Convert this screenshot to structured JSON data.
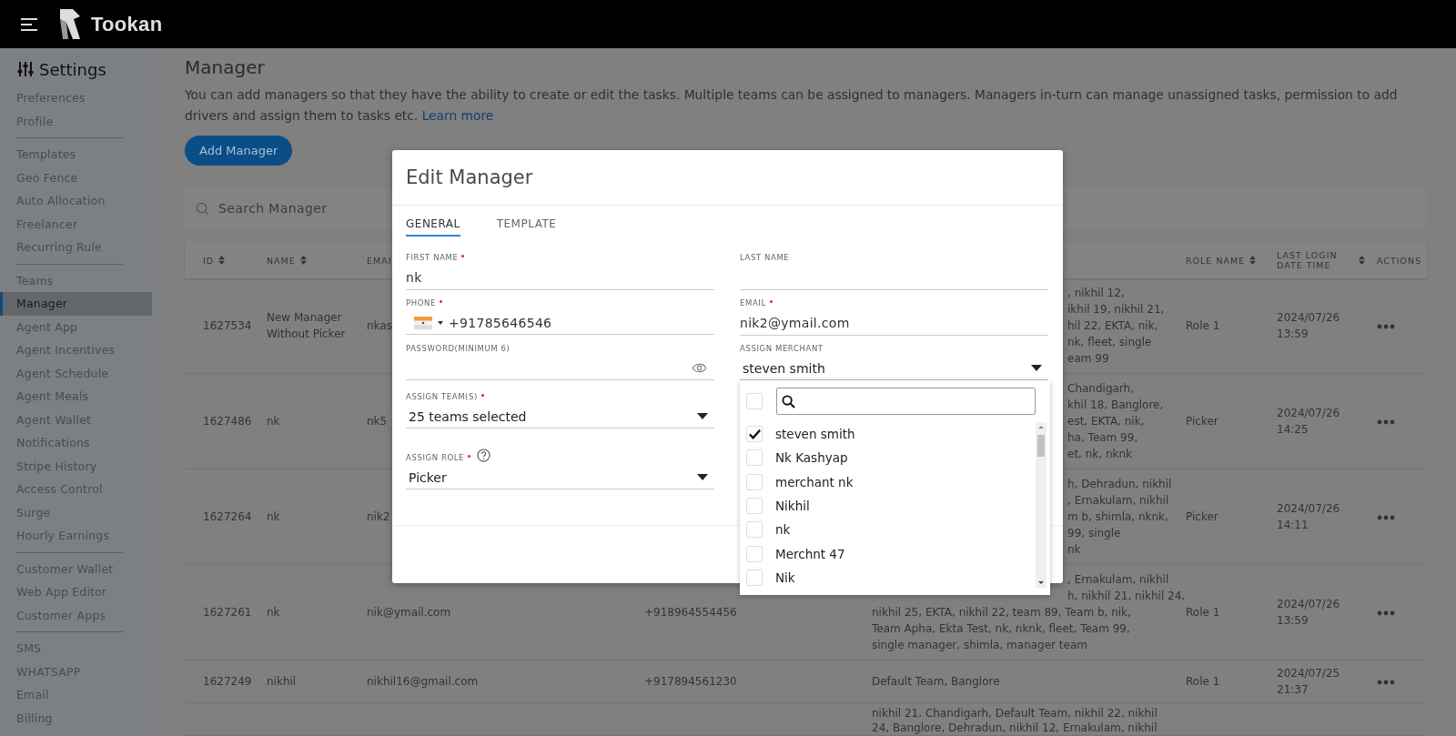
{
  "app": {
    "name": "Tookan"
  },
  "sidebar": {
    "title": "Settings",
    "groups": [
      [
        {
          "label": "Preferences",
          "selected": false
        },
        {
          "label": "Profile",
          "selected": false
        }
      ],
      [
        {
          "label": "Templates",
          "selected": false
        },
        {
          "label": "Geo Fence",
          "selected": false
        },
        {
          "label": "Auto Allocation",
          "selected": false
        },
        {
          "label": "Freelancer",
          "selected": false
        },
        {
          "label": "Recurring Rule",
          "selected": false
        }
      ],
      [
        {
          "label": "Teams",
          "selected": false
        },
        {
          "label": "Manager",
          "selected": true
        },
        {
          "label": "Agent App",
          "selected": false
        },
        {
          "label": "Agent Incentives",
          "selected": false
        },
        {
          "label": "Agent Schedule",
          "selected": false
        },
        {
          "label": "Agent Meals",
          "selected": false
        },
        {
          "label": "Agent Wallet",
          "selected": false
        },
        {
          "label": "Notifications",
          "selected": false
        },
        {
          "label": "Stripe History",
          "selected": false
        },
        {
          "label": "Access Control",
          "selected": false
        },
        {
          "label": "Surge",
          "selected": false
        },
        {
          "label": "Hourly Earnings",
          "selected": false
        }
      ],
      [
        {
          "label": "Customer Wallet",
          "selected": false
        },
        {
          "label": "Web App Editor",
          "selected": false
        },
        {
          "label": "Customer Apps",
          "selected": false
        }
      ],
      [
        {
          "label": "SMS",
          "selected": false
        },
        {
          "label": "WHATSAPP",
          "selected": false
        },
        {
          "label": "Email",
          "selected": false
        },
        {
          "label": "Billing",
          "selected": false
        }
      ]
    ]
  },
  "page": {
    "title": "Manager",
    "description": "You can add managers so that they have the ability to create or edit the tasks. Multiple teams can be assigned to managers. Managers in-turn can manage unassigned tasks, permission to add drivers and assign them to tasks etc.",
    "link": "Learn more",
    "add_button": "Add Manager",
    "search_placeholder": "Search Manager"
  },
  "table": {
    "columns": [
      {
        "label": "ID",
        "sortable": true
      },
      {
        "label": "NAME",
        "sortable": true
      },
      {
        "label": "EMAI",
        "sortable": false
      },
      {
        "label": "ROLE NAME",
        "sortable": true
      },
      {
        "label": "LAST LOGIN DATE TIME",
        "sortable": true
      },
      {
        "label": "ACTIONS",
        "sortable": false
      }
    ],
    "rows": [
      {
        "id": "1627534",
        "name": "New Manager Without Picker",
        "email": "nkas",
        "teams": [
          {
            "text": ", nikhil 12,",
            "clipped": true
          },
          {
            "text": "ikhil 19, nikhil 21,",
            "clipped": true
          },
          {
            "text": "hil 22, EKTA, nik,",
            "clipped": true
          },
          {
            "text": "nk, fleet, single",
            "clipped": true
          },
          {
            "text": "eam 99",
            "clipped": true
          }
        ],
        "role": "Role 1",
        "last_login": "2024/07/26 13:59"
      },
      {
        "id": "1627486",
        "name": "nk",
        "email": "nk5",
        "teams": [
          {
            "text": "Chandigarh,",
            "clipped": true
          },
          {
            "text": "khil 18, Banglore,",
            "clipped": true
          },
          {
            "text": "est, EKTA, nik,",
            "clipped": true
          },
          {
            "text": "ha, Team 99,",
            "clipped": true
          },
          {
            "text": "et, nk, nknk",
            "clipped": true
          }
        ],
        "role": "Picker",
        "last_login": "2024/07/26 14:25"
      },
      {
        "id": "1627264",
        "name": "nk",
        "email": "nik2",
        "teams": [
          {
            "text": "h, Dehradun, nikhil",
            "clipped": true
          },
          {
            "text": ", Ernakulam, nikhil",
            "clipped": true
          },
          {
            "text": "m b, shimla, nknk,",
            "clipped": true
          },
          {
            "text": "99, single",
            "clipped": true
          },
          {
            "text": "nk",
            "clipped": true
          }
        ],
        "role": "Picker",
        "last_login": "2024/07/26 14:11"
      },
      {
        "id": "1627261",
        "name": "nk",
        "email": "nik@ymail.com",
        "phone": "+918964554456",
        "teams": [
          {
            "text": ", Ernakulam, nikhil",
            "clipped": true
          },
          {
            "text": "h, nikhil 21, nikhil 24,",
            "clipped": true
          },
          {
            "text": "nikhil 25, EKTA, nikhil 22, team 89, Team b, nik,",
            "clipped": false
          },
          {
            "text": "Team Apha, Ekta Test, nk, nknk, fleet, Team 99,",
            "clipped": false
          },
          {
            "text": "single manager, shimla, manager team",
            "clipped": false
          }
        ],
        "role": "Role 1",
        "last_login": "2024/07/26 13:59"
      },
      {
        "id": "1627249",
        "name": "nikhil",
        "email": "nikhil16@gmail.com",
        "phone": "+917894561230",
        "teams": [
          {
            "text": "Default Team, Banglore",
            "clipped": false
          }
        ],
        "role": "Role 1",
        "last_login": "2024/07/25 21:37"
      },
      {
        "teams": [
          {
            "text": "nikhil 21, Chandigarh, Default Team, nikhil 22, nikhil",
            "clipped": false
          },
          {
            "text": "24, Banglore, Dehradun, nikhil 12, Ernakulam, nikhil",
            "clipped": false
          }
        ]
      }
    ]
  },
  "modal": {
    "title": "Edit Manager",
    "tabs": [
      {
        "label": "GENERAL",
        "selected": true
      },
      {
        "label": "TEMPLATE",
        "selected": false
      }
    ],
    "fields": [
      {
        "kind": "text",
        "label": "FIRST NAME",
        "required": true,
        "value": "nk"
      },
      {
        "kind": "text",
        "label": "LAST NAME",
        "required": false
      },
      {
        "kind": "phone",
        "label": "PHONE",
        "required": true,
        "value": "+91785646546"
      },
      {
        "kind": "text",
        "label": "EMAIL",
        "required": true,
        "value": "nik2@ymail.com"
      },
      {
        "kind": "password",
        "label": "PASSWORD(MINIMUM 6)",
        "required": false
      },
      {
        "kind": "select",
        "label": "ASSIGN MERCHANT",
        "required": false,
        "value": "steven smith",
        "expanded": true
      },
      {
        "kind": "select",
        "label": "ASSIGN TEAM(S)",
        "required": true,
        "value": "25 teams selected",
        "expanded": false
      },
      {
        "kind": "select",
        "label": "ASSIGN ROLE",
        "required": true,
        "value": "Picker",
        "expanded": false,
        "help": true
      }
    ],
    "merchant_dropdown": {
      "select_all_checked": false,
      "options": [
        {
          "label": "steven smith",
          "checked": true
        },
        {
          "label": "Nk Kashyap",
          "checked": false
        },
        {
          "label": "merchant nk",
          "checked": false
        },
        {
          "label": "Nikhil",
          "checked": false
        },
        {
          "label": "nk",
          "checked": false
        },
        {
          "label": "Merchnt 47",
          "checked": false
        },
        {
          "label": "Nik",
          "checked": false
        }
      ]
    }
  }
}
